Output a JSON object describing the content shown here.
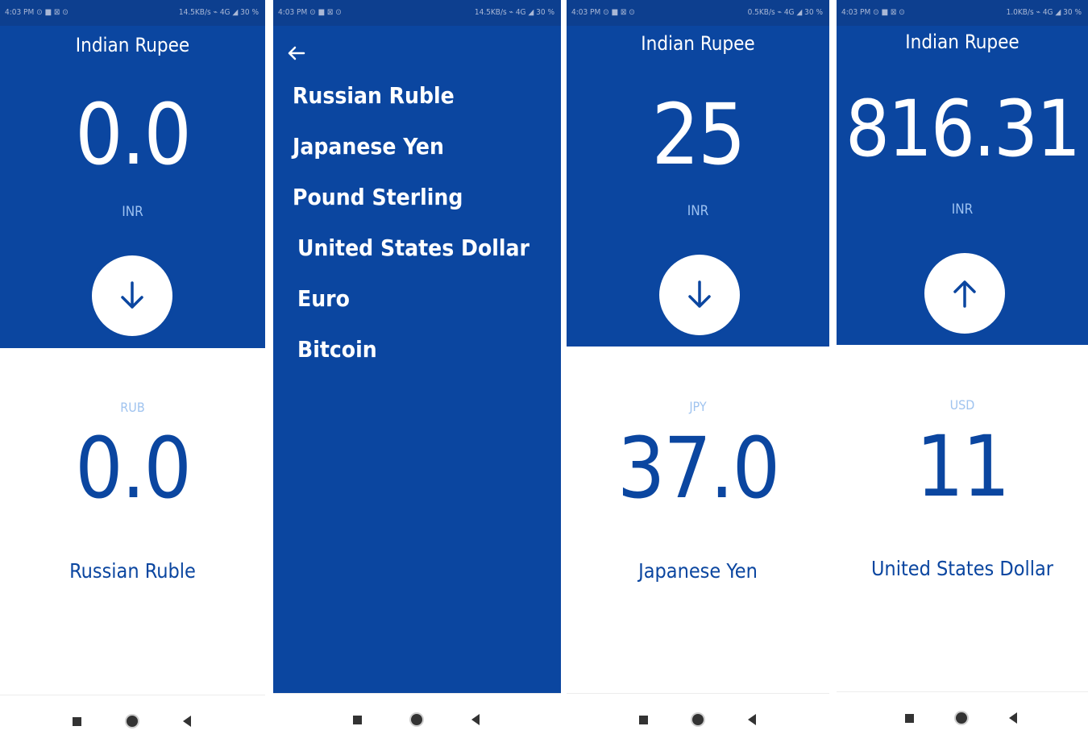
{
  "status_bars": [
    {
      "left": "4:03 PM ⊙ ■ ⊠ ⊙",
      "right": "14.5KB/s ⌁ 4G ◢ 30 %"
    },
    {
      "left": "4:03 PM ⊙ ■ ⊠ ⊙",
      "right": "14.5KB/s ⌁ 4G ◢ 30 %"
    },
    {
      "left": "4:03 PM ⊙ ■ ⊠ ⊙",
      "right": "0.5KB/s ⌁ 4G ◢ 30 %"
    },
    {
      "left": "4:03 PM ⊙ ■ ⊠ ⊙",
      "right": "1.0KB/s ⌁ 4G ◢ 30 %"
    }
  ],
  "screen1": {
    "base_title": "Indian Rupee",
    "base_amount": "0.0",
    "base_code": "INR",
    "swap_icon": "arrow-down-icon",
    "target_code": "RUB",
    "target_amount": "0.0",
    "target_name": "Russian Ruble"
  },
  "screen2": {
    "back_icon": "arrow-left-icon",
    "currencies": [
      "Russian Ruble",
      "Japanese Yen",
      "Pound Sterling",
      "United States Dollar",
      "Euro",
      "Bitcoin"
    ]
  },
  "screen3": {
    "base_title": "Indian Rupee",
    "base_amount": "25",
    "base_code": "INR",
    "swap_icon": "arrow-down-icon",
    "target_code": "JPY",
    "target_amount": "37.0",
    "target_name": "Japanese Yen"
  },
  "screen4": {
    "base_title": "Indian Rupee",
    "base_amount": "816.31",
    "base_code": "INR",
    "swap_icon": "arrow-up-icon",
    "target_code": "USD",
    "target_amount": "11",
    "target_name": "United States Dollar"
  },
  "nav_icons": [
    "recent-apps-icon",
    "home-icon",
    "back-icon"
  ],
  "colors": {
    "primary": "#0b46a0",
    "status_bar": "#0d3f8f",
    "accent_light": "#9fc3ef",
    "background": "#ffffff"
  }
}
